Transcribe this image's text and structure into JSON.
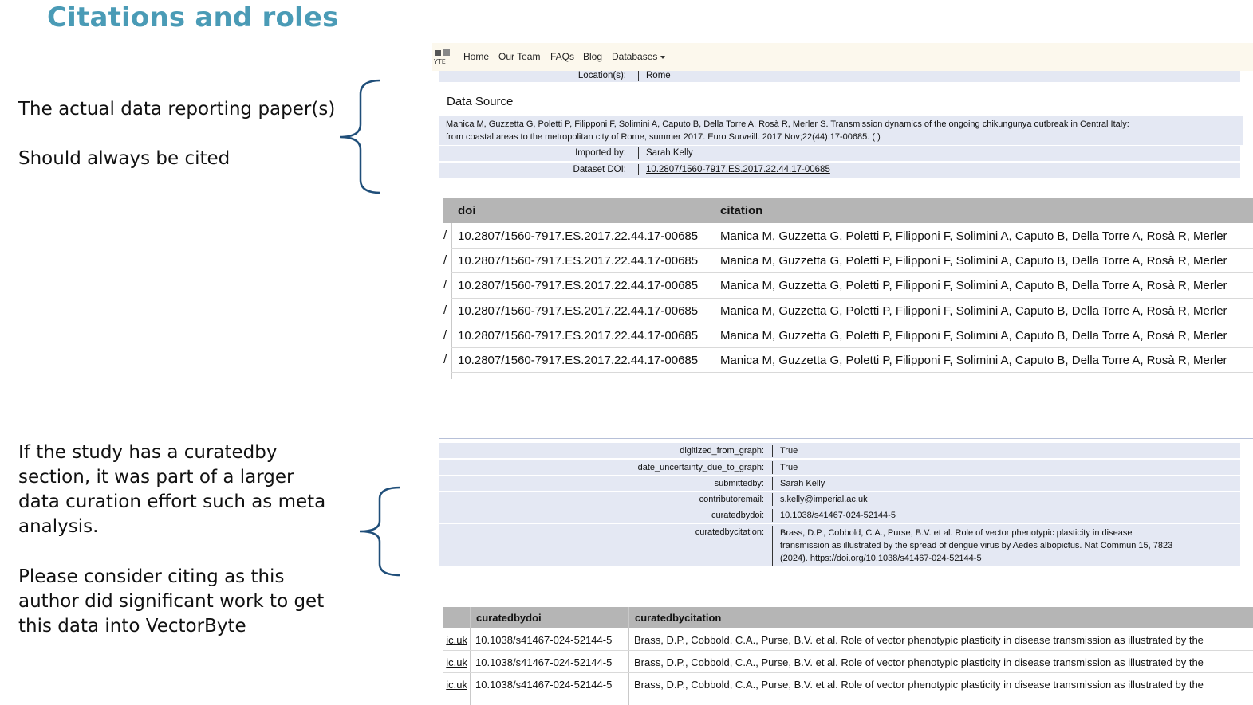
{
  "slide": {
    "title": "Citations and roles",
    "note1_line1": "The actual data reporting paper(s)",
    "note1_line2": "Should always be cited",
    "note2_p1": [
      "If the study has a curatedby",
      "section, it was part of a larger",
      "data curation effort such as meta",
      "analysis."
    ],
    "note2_p2": [
      "Please consider citing as this",
      "author did significant work to get",
      "this data into VectorByte"
    ]
  },
  "nav": {
    "logo_icon": "vectorbyte-logo-icon",
    "items": [
      "Home",
      "Our Team",
      "FAQs",
      "Blog",
      "Databases"
    ],
    "dropdown_icon": "caret-down-icon"
  },
  "dataset": {
    "location_label": "Location(s):",
    "location_value": "Rome",
    "data_source_title": "Data Source",
    "citation_line1": "Manica M, Guzzetta G, Poletti P, Filipponi F, Solimini A, Caputo B, Della Torre A, Rosà R, Merler S. Transmission dynamics of the ongoing chikungunya outbreak in Central Italy:",
    "citation_line2": "from coastal areas to the metropolitan city of Rome, summer 2017. Euro Surveill. 2017 Nov;22(44):17-00685. ( )",
    "imported_by_label": "Imported by:",
    "imported_by_value": "Sarah Kelly",
    "doi_label": "Dataset DOI:",
    "doi_value": "10.2807/1560-7917.ES.2017.22.44.17-00685"
  },
  "table1": {
    "headers": [
      "doi",
      "citation"
    ],
    "rows": [
      [
        "10.2807/1560-7917.ES.2017.22.44.17-00685",
        "Manica M, Guzzetta G, Poletti P, Filipponi F, Solimini A, Caputo B, Della Torre A, Rosà R, Merler"
      ],
      [
        "10.2807/1560-7917.ES.2017.22.44.17-00685",
        "Manica M, Guzzetta G, Poletti P, Filipponi F, Solimini A, Caputo B, Della Torre A, Rosà R, Merler"
      ],
      [
        "10.2807/1560-7917.ES.2017.22.44.17-00685",
        "Manica M, Guzzetta G, Poletti P, Filipponi F, Solimini A, Caputo B, Della Torre A, Rosà R, Merler"
      ],
      [
        "10.2807/1560-7917.ES.2017.22.44.17-00685",
        "Manica M, Guzzetta G, Poletti P, Filipponi F, Solimini A, Caputo B, Della Torre A, Rosà R, Merler"
      ],
      [
        "10.2807/1560-7917.ES.2017.22.44.17-00685",
        "Manica M, Guzzetta G, Poletti P, Filipponi F, Solimini A, Caputo B, Della Torre A, Rosà R, Merler"
      ],
      [
        "10.2807/1560-7917.ES.2017.22.44.17-00685",
        "Manica M, Guzzetta G, Poletti P, Filipponi F, Solimini A, Caputo B, Della Torre A, Rosà R, Merler"
      ]
    ]
  },
  "meta2": {
    "rows": [
      {
        "k": "digitized_from_graph:",
        "v": "True"
      },
      {
        "k": "date_uncertainty_due_to_graph:",
        "v": "True"
      },
      {
        "k": "submittedby:",
        "v": "Sarah Kelly"
      },
      {
        "k": "contributoremail:",
        "v": "s.kelly@imperial.ac.uk"
      },
      {
        "k": "curatedbydoi:",
        "v": "10.1038/s41467-024-52144-5"
      }
    ],
    "curated_label": "curatedbycitation:",
    "curated_lines": [
      "Brass, D.P., Cobbold, C.A., Purse, B.V. et al. Role of vector phenotypic plasticity in disease",
      "transmission as illustrated by the spread of dengue virus by Aedes albopictus. Nat Commun 15, 7823",
      "(2024). https://doi.org/10.1038/s41467-024-52144-5"
    ]
  },
  "table2": {
    "headers": [
      "curatedbydoi",
      "curatedbycitation"
    ],
    "rows": [
      [
        "ic.uk",
        "10.1038/s41467-024-52144-5",
        "Brass, D.P., Cobbold, C.A., Purse, B.V. et al. Role of vector phenotypic plasticity in disease transmission as illustrated by the"
      ],
      [
        "ic.uk",
        "10.1038/s41467-024-52144-5",
        "Brass, D.P., Cobbold, C.A., Purse, B.V. et al. Role of vector phenotypic plasticity in disease transmission as illustrated by the"
      ],
      [
        "ic.uk",
        "10.1038/s41467-024-52144-5",
        "Brass, D.P., Cobbold, C.A., Purse, B.V. et al. Role of vector phenotypic plasticity in disease transmission as illustrated by the"
      ]
    ]
  },
  "colors": {
    "title": "#4a9bb6",
    "brace": "#1f4e79",
    "header_bg": "#b5b5b5",
    "meta_bg": "#e4e8f3",
    "nav_bg": "#fcf8ed"
  }
}
